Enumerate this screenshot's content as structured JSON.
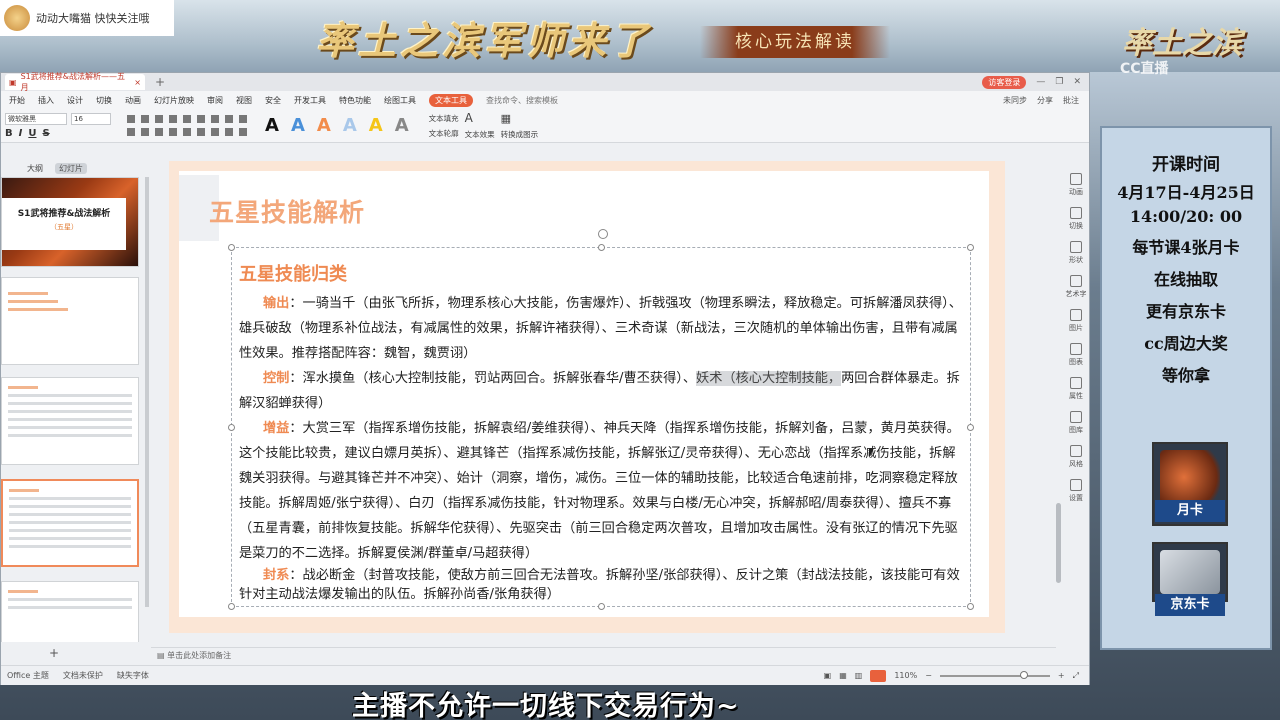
{
  "stream": {
    "tag_text": "动动大嘴猫 快快关注哦",
    "banner_title": "率土之滨军师来了",
    "banner_subtitle": "核心玩法解读",
    "game_logo": "率土之滨",
    "cc_logo": "CC直播",
    "subtitle": "主播不允许一切线下交易行为~"
  },
  "promo": {
    "head": "开课时间",
    "date_range": "4月17日-4月25日",
    "time": "14:00/20: 00",
    "line1": "每节课4张月卡",
    "line2": "在线抽取",
    "line3": "更有京东卡",
    "line4": "cc周边大奖",
    "line5": "等你拿",
    "card1_label": "月卡",
    "card2_label": "京东卡"
  },
  "window": {
    "doc_tab": "S1武将推荐&战法解析——五月",
    "login_button": "访客登录",
    "menus": [
      "开始",
      "插入",
      "设计",
      "切换",
      "动画",
      "幻灯片放映",
      "审阅",
      "视图",
      "安全",
      "开发工具",
      "特色功能",
      "绘图工具"
    ],
    "active_menu": "文本工具",
    "search_placeholder": "查找命令、搜索模板",
    "menu_right": [
      "未同步",
      "分享",
      "批注"
    ],
    "font_name": "微软雅黑",
    "font_size": "16",
    "format_buttons": [
      "B",
      "I",
      "U",
      "S"
    ],
    "wordart_glyph": "A",
    "text_fill": "文本填充",
    "text_outline": "文本轮廓",
    "text_effect": "文本效果",
    "convert_smartart": "转换成图示"
  },
  "panel": {
    "tab_outline": "大纲",
    "tab_slides": "幻灯片",
    "cover_title": "S1武将推荐&战法解析",
    "cover_sub": "（五星）"
  },
  "slide": {
    "title": "五星技能解析",
    "section_title": "五星技能归类",
    "paragraphs": [
      {
        "key": "输出",
        "text": "：一骑当千（由张飞所拆，物理系核心大技能，伤害爆炸）、折戟强攻（物理系瞬法，释放稳定。可拆解潘凤获得）、雄兵破敌（物理系补位战法，有减属性的效果，拆解许褚获得）、三术奇谋（新战法，三次随机的单体输出伤害，且带有减属性效果。推荐搭配阵容：魏智，魏贾诩）"
      },
      {
        "key": "控制",
        "text": "：浑水摸鱼（核心大控制技能，罚站两回合。拆解张春华/曹丕获得）、",
        "highlight": "妖术（核心大控制技能，",
        "tail": "两回合群体暴走。拆解汉貂蝉获得）"
      },
      {
        "key": "增益",
        "text": "：大赏三军（指挥系增伤技能，拆解袁绍/姜维获得）、神兵天降（指挥系增伤技能，拆解刘备，吕蒙，黄月英获得。这个技能比较贵，建议白嫖月英拆）、避其锋芒（指挥系减伤技能，拆解张辽/灵帝获得）、无心恋战（指挥系减伤技能，拆解魏关羽获得。与避其锋芒并不冲突）、始计（洞察，增伤，减伤。三位一体的辅助技能，比较适合龟速前排，吃洞察稳定释放技能。拆解周姬/张宁获得）、白刃（指挥系减伤技能，针对物理系。效果与白楼/无心冲突，拆解郝昭/周泰获得）、擅兵不寡（五星青囊，前排恢复技能。拆解华佗获得）、先驱突击（前三回合稳定两次普攻，且增加攻击属性。没有张辽的情况下先驱是菜刀的不二选择。拆解夏侯渊/群董卓/马超获得）"
      },
      {
        "key": "封系",
        "text": "：战必断金（封普攻技能，使敌方前三回合无法普攻。拆解孙坚/张郃获得）、反计之策（封战法技能，该技能可有效针对主动战法爆发输出的队伍。拆解孙尚香/张角获得）"
      }
    ]
  },
  "right_tools": [
    "动画",
    "切换",
    "形状",
    "艺术字",
    "图片",
    "图表",
    "属性",
    "图库",
    "风格",
    "设置"
  ],
  "notes_placeholder": "单击此处添加备注",
  "status": {
    "theme": "Office 主题",
    "protect": "文档未保护",
    "missing_font": "缺失字体",
    "zoom": "110%"
  }
}
